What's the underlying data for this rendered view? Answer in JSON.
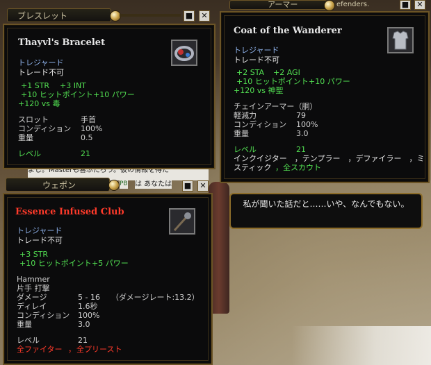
{
  "background": {
    "accent_gold": "#c9a24a",
    "frame": "#6b5426"
  },
  "bracelet_window": {
    "title": "ブレスレット",
    "name": "Thayvl's Bracelet",
    "treasure": "トレジャード",
    "no_trade": "トレード不可",
    "stats": [
      "+1 STR",
      "+3 INT"
    ],
    "stats2": [
      "+10 ヒットポイント",
      "+10 パワー"
    ],
    "resist": "+120 vs 毒",
    "slot_label": "スロット",
    "slot_value": "手首",
    "condition_label": "コンディション",
    "condition_value": "100%",
    "weight_label": "重量",
    "weight_value": "0.5",
    "level_label": "レベル",
    "level_value": "21",
    "icon": "bracelet-icon"
  },
  "armor_window": {
    "title": "アーマー",
    "title_extra": "efenders.",
    "name": "Coat of the Wanderer",
    "treasure": "トレジャード",
    "no_trade": "トレード不可",
    "stats": [
      "+2 STA",
      "+2 AGI"
    ],
    "stats2": [
      "+10 ヒットポイント",
      "+10 パワー"
    ],
    "resist": "+120 vs 神聖",
    "type_label": "チェインアーマー（胴）",
    "mitigation_label": "軽減力",
    "mitigation_value": "79",
    "condition_label": "コンディション",
    "condition_value": "100%",
    "weight_label": "重量",
    "weight_value": "3.0",
    "level_label": "レベル",
    "level_value": "21",
    "classes_line1": "インクイジター　，テンプラー　，デファイラー　，ミ",
    "classes_line2a": "スティック",
    "classes_line2b": "，全スカウト",
    "icon": "chainmail-icon"
  },
  "weapon_window": {
    "title": "ウェポン",
    "name": "Essence Infused Club",
    "treasure": "トレジャード",
    "no_trade": "トレード不可",
    "stats": [
      "+3 STR"
    ],
    "stats2": [
      "+10 ヒットポイント",
      "+5 パワー"
    ],
    "weapon_type": "Hammer",
    "grip_label": "片手 打撃",
    "damage_label": "ダメージ",
    "damage_value": "5 - 16",
    "damage_rate": "（ダメージレート:13.2）",
    "delay_label": "ディレイ",
    "delay_value": "1.6秒",
    "condition_label": "コンディション",
    "condition_value": "100%",
    "weight_label": "重量",
    "weight_value": "3.0",
    "level_label": "レベル",
    "level_value": "21",
    "classes_a": "全ファイター",
    "classes_sep": "，",
    "classes_b": "全プリースト",
    "icon": "club-icon"
  },
  "speech_bubble": {
    "text": "私が聞いた話だと……いや、なんでもない。"
  },
  "chat_strip": {
    "line1": "よし。Masterも喜ぶだろう。彼の情報を得た",
    "line2": "PB",
    "line3": "は あなたは"
  },
  "buttons": {
    "minimize": "■",
    "close": "✕"
  }
}
